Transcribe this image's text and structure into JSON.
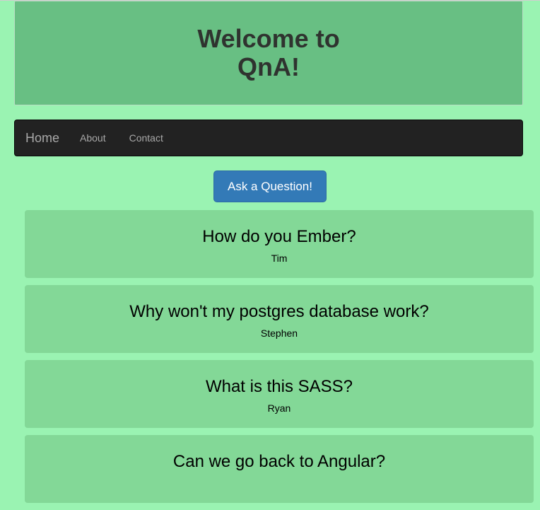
{
  "header": {
    "title": "Welcome to QnA!"
  },
  "navbar": {
    "brand": "Home",
    "links": [
      "About",
      "Contact"
    ]
  },
  "actions": {
    "ask_label": "Ask a Question!"
  },
  "questions": [
    {
      "title": "How do you Ember?",
      "author": "Tim"
    },
    {
      "title": "Why won't my postgres database work?",
      "author": "Stephen"
    },
    {
      "title": "What is this SASS?",
      "author": "Ryan"
    },
    {
      "title": "Can we go back to Angular?",
      "author": ""
    }
  ],
  "colors": {
    "page_background": "#9af3b2",
    "jumbotron": "#68bf83",
    "navbar": "#222222",
    "primary_button": "#337ab7",
    "card": "#83d897"
  }
}
